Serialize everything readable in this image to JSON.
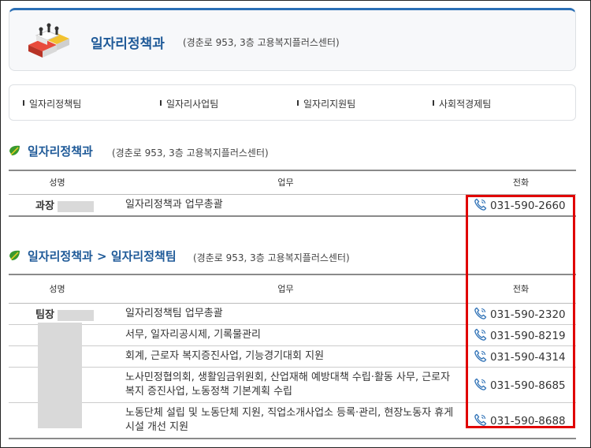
{
  "header": {
    "title": "일자리정책과",
    "address": "(경춘로 953, 3층 고용복지플러스센터)"
  },
  "teams": [
    "일자리정책팀",
    "일자리사업팀",
    "일자리지원팀",
    "사회적경제팀"
  ],
  "section1": {
    "title": "일자리정책과",
    "address": "(경춘로 953, 3층 고용복지플러스센터)",
    "columns": {
      "name": "성명",
      "duty": "업무",
      "phone": "전화"
    },
    "rows": [
      {
        "name": "과장",
        "duty": "일자리정책과 업무총괄",
        "phone": "031-590-2660"
      }
    ]
  },
  "section2": {
    "title": "일자리정책과 > 일자리정책팀",
    "address": "(경춘로 953, 3층 고용복지플러스센터)",
    "columns": {
      "name": "성명",
      "duty": "업무",
      "phone": "전화"
    },
    "rows": [
      {
        "name": "팀장",
        "duty": "일자리정책팀 업무총괄",
        "phone": "031-590-2320"
      },
      {
        "name": "",
        "duty": "서무, 일자리공시제, 기록물관리",
        "phone": "031-590-8219"
      },
      {
        "name": "",
        "duty": "회계, 근로자 복지증진사업, 기능경기대회 지원",
        "phone": "031-590-4314"
      },
      {
        "name": "",
        "duty": "노사민정협의회, 생활임금위원회, 산업재해 예방대책 수립·활동 사무, 근로자 복지 증진사업, 노동정책 기본계획 수립",
        "phone": "031-590-8685"
      },
      {
        "name": "",
        "duty": "노동단체 설립 및 노동단체 지원, 직업소개사업소 등록·관리, 현장노동자 휴게시설 개선 지원",
        "phone": "031-590-8688"
      }
    ]
  },
  "colors": {
    "accent": "#1f5a98",
    "highlight": "#e00000",
    "phone_icon": "#2b6fb5"
  },
  "icons": {
    "logo": "department-logo-icon",
    "leaf": "leaf-bullet-icon",
    "phone": "phone-icon"
  }
}
